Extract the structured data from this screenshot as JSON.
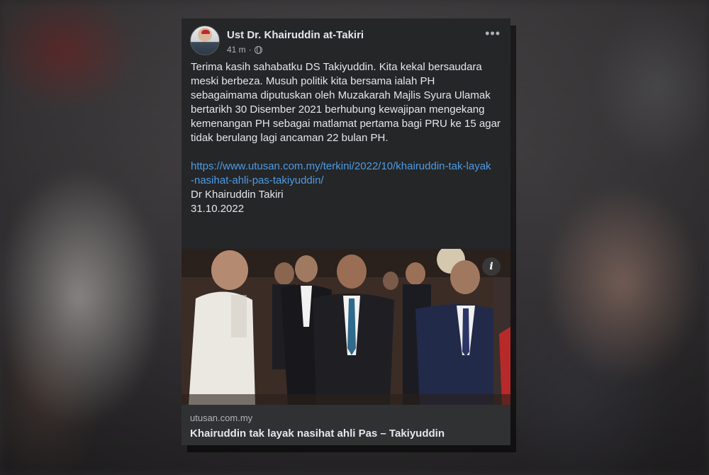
{
  "post": {
    "author": "Ust Dr. Khairuddin at-Takiri",
    "time": "41 m",
    "separator": "·",
    "more_label": "•••",
    "icons": {
      "more": "more-horizontal-icon",
      "privacy": "globe-icon",
      "info": "info-icon"
    },
    "body": "Terima kasih sahabatku DS Takiyuddin. Kita kekal bersaudara meski berbeza. Musuh politik kita bersama ialah PH sebagaimama diputuskan oleh Muzakarah Majlis Syura Ulamak bertarikh 30 Disember 2021 berhubung kewajipan mengekang kemenangan PH sebagai matlamat pertama bagi PRU ke 15 agar tidak berulang lagi ancaman 22 bulan PH.",
    "link": "https://www.utusan.com.my/terkini/2022/10/khairuddin-tak-layak-nasihat-ahli-pas-takiyuddin/",
    "signature_name": "Dr Khairuddin Takiri",
    "signature_date": "31.10.2022"
  },
  "preview": {
    "info_label": "i",
    "domain": "utusan.com.my",
    "headline": "Khairuddin tak layak nasihat ahli Pas – Takiyuddin"
  },
  "colors": {
    "card_bg": "#252628",
    "preview_bg": "#303133",
    "text": "#e4e6eb",
    "secondary_text": "#b0b3b8",
    "link": "#4d9be4"
  }
}
